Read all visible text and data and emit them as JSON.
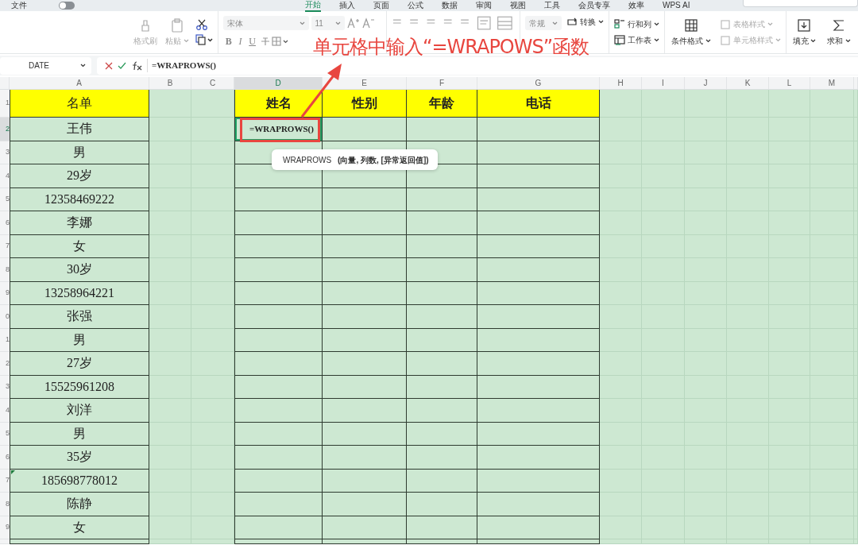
{
  "menu": {
    "file": "文件",
    "autosave_on": false,
    "tabs": [
      {
        "label": "开始",
        "selected": true
      },
      {
        "label": "插入",
        "selected": false
      },
      {
        "label": "页面",
        "selected": false
      },
      {
        "label": "公式",
        "selected": false
      },
      {
        "label": "数据",
        "selected": false
      },
      {
        "label": "审阅",
        "selected": false
      },
      {
        "label": "视图",
        "selected": false
      },
      {
        "label": "工具",
        "selected": false
      },
      {
        "label": "会员专享",
        "selected": false
      },
      {
        "label": "效率",
        "selected": false
      },
      {
        "label": "WPS AI",
        "selected": false
      }
    ]
  },
  "ribbon": {
    "clipboard": [
      {
        "label": "格式刷",
        "disabled": true,
        "dropdown": false
      },
      {
        "label": "粘贴",
        "disabled": true,
        "dropdown": true
      }
    ],
    "font_name": "宋体",
    "font_size": "11",
    "style_buttons": [
      "B",
      "I",
      "U"
    ],
    "number_format": "常规",
    "convert": "转换",
    "sheet_tools": [
      {
        "label": "行和列",
        "dropdown": true
      },
      {
        "label": "工作表",
        "dropdown": true
      }
    ],
    "conditional_format": "条件格式",
    "style_tools": [
      {
        "label": "表格样式",
        "disabled": true
      },
      {
        "label": "单元格样式",
        "disabled": true
      }
    ],
    "edit_tools": [
      {
        "label": "填充",
        "dropdown": true
      },
      {
        "label": "求和",
        "dropdown": true
      }
    ]
  },
  "name_box": "DATE",
  "formula": "=WRAPROWS()",
  "columns": [
    {
      "label": "A",
      "selected": false,
      "boxed": true
    },
    {
      "label": "B",
      "selected": false,
      "boxed": false
    },
    {
      "label": "C",
      "selected": false,
      "boxed": false
    },
    {
      "label": "D",
      "selected": true,
      "boxed": true
    },
    {
      "label": "E",
      "selected": false,
      "boxed": true
    },
    {
      "label": "F",
      "selected": false,
      "boxed": true
    },
    {
      "label": "G",
      "selected": false,
      "boxed": true
    },
    {
      "label": "H",
      "selected": false,
      "boxed": false
    },
    {
      "label": "I",
      "selected": false,
      "boxed": false
    },
    {
      "label": "J",
      "selected": false,
      "boxed": false
    },
    {
      "label": "K",
      "selected": false,
      "boxed": false
    },
    {
      "label": "L",
      "selected": false,
      "boxed": false
    },
    {
      "label": "M",
      "selected": false,
      "boxed": false
    }
  ],
  "rows": [
    {
      "number": "1",
      "selected": false,
      "cells": {
        "A": {
          "text": "名单",
          "highlight": true
        },
        "D": {
          "text": "姓名",
          "highlight": true,
          "bold": true
        },
        "E": {
          "text": "性别",
          "highlight": true,
          "bold": true
        },
        "F": {
          "text": "年龄",
          "highlight": true,
          "bold": true
        },
        "G": {
          "text": "电话",
          "highlight": true,
          "bold": true
        }
      }
    },
    {
      "number": "2",
      "selected": true,
      "cells": {
        "A": {
          "text": "王伟"
        },
        "D": {
          "text": "=WRAPROWS()",
          "selected": true,
          "bold": true
        }
      }
    },
    {
      "number": "3",
      "selected": false,
      "cells": {
        "A": {
          "text": "男"
        }
      }
    },
    {
      "number": "4",
      "selected": false,
      "cells": {
        "A": {
          "text": "29岁"
        }
      }
    },
    {
      "number": "5",
      "selected": false,
      "cells": {
        "A": {
          "text": "12358469222"
        }
      }
    },
    {
      "number": "6",
      "selected": false,
      "cells": {
        "A": {
          "text": "李娜"
        }
      }
    },
    {
      "number": "7",
      "selected": false,
      "cells": {
        "A": {
          "text": "女"
        }
      }
    },
    {
      "number": "8",
      "selected": false,
      "cells": {
        "A": {
          "text": "30岁"
        }
      }
    },
    {
      "number": "9",
      "selected": false,
      "cells": {
        "A": {
          "text": "13258964221"
        }
      }
    },
    {
      "number": "0",
      "selected": false,
      "cells": {
        "A": {
          "text": "张强"
        }
      }
    },
    {
      "number": "1",
      "selected": false,
      "cells": {
        "A": {
          "text": "男"
        }
      }
    },
    {
      "number": "2",
      "selected": false,
      "cells": {
        "A": {
          "text": "27岁"
        }
      }
    },
    {
      "number": "3",
      "selected": false,
      "cells": {
        "A": {
          "text": "15525961208"
        }
      }
    },
    {
      "number": "4",
      "selected": false,
      "cells": {
        "A": {
          "text": "刘洋"
        }
      }
    },
    {
      "number": "5",
      "selected": false,
      "cells": {
        "A": {
          "text": "男"
        }
      }
    },
    {
      "number": "6",
      "selected": false,
      "cells": {
        "A": {
          "text": "35岁"
        }
      }
    },
    {
      "number": "7",
      "selected": false,
      "cells": {
        "A": {
          "text": "185698778012",
          "flag": true
        }
      }
    },
    {
      "number": "8",
      "selected": false,
      "cells": {
        "A": {
          "text": "陈静"
        }
      }
    },
    {
      "number": "9",
      "selected": false,
      "cells": {
        "A": {
          "text": "女"
        }
      }
    },
    {
      "selected": false,
      "cells": {}
    }
  ],
  "tooltip": {
    "function": "WRAPROWS",
    "args": "(向量, 列数, [异常返回值])"
  },
  "annotation": "单元格中输入“=WRAPOWS”函数"
}
